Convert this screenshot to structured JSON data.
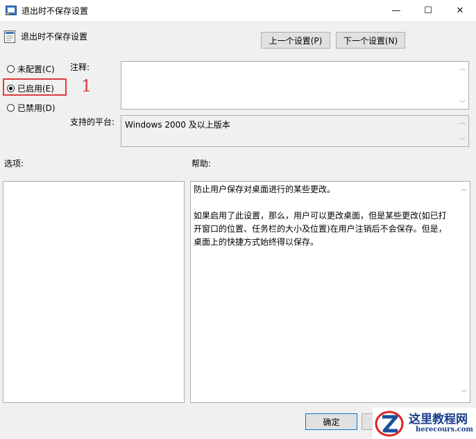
{
  "window": {
    "title": "退出时不保存设置",
    "minimize_glyph": "—",
    "maximize_glyph": "☐",
    "close_glyph": "✕"
  },
  "policy": {
    "name": "退出时不保存设置",
    "prev_button": "上一个设置(P)",
    "next_button": "下一个设置(N)"
  },
  "radios": [
    {
      "label": "未配置(C)",
      "checked": false
    },
    {
      "label": "已启用(E)",
      "checked": true
    },
    {
      "label": "已禁用(D)",
      "checked": false
    }
  ],
  "annotation_marker": "1",
  "highlight_color": "#e03a3a",
  "comment": {
    "label": "注释:",
    "value": ""
  },
  "platform": {
    "label": "支持的平台:",
    "value": "Windows 2000 及以上版本"
  },
  "options_label": "选项:",
  "help_label": "帮助:",
  "help_text": [
    "防止用户保存对桌面进行的某些更改。",
    "如果启用了此设置，那么，用户可以更改桌面，但是某些更改(如已打开窗口的位置、任务栏的大小及位置)在用户注销后不会保存。但是，桌面上的快捷方式始终得以保存。"
  ],
  "footer": {
    "ok_button": "确定"
  },
  "watermark": {
    "text": "这里教程网",
    "url": "herecours.com"
  }
}
